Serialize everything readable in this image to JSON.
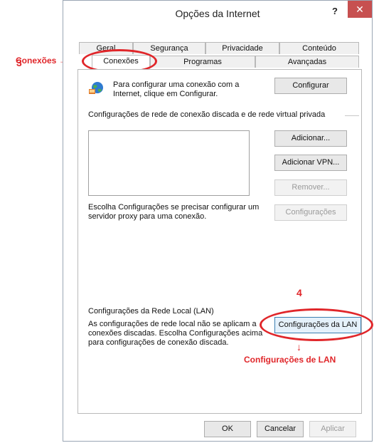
{
  "window": {
    "title": "Opções da Internet",
    "help_label": "?",
    "close_label": "✕"
  },
  "tabs_row1": [
    {
      "label": "Geral"
    },
    {
      "label": "Segurança"
    },
    {
      "label": "Privacidade"
    },
    {
      "label": "Conteúdo"
    }
  ],
  "tabs_row2": [
    {
      "label": "Conexões",
      "active": true
    },
    {
      "label": "Programas"
    },
    {
      "label": "Avançadas"
    }
  ],
  "setup": {
    "text": "Para configurar uma conexão com a Internet, clique em Configurar.",
    "button": "Configurar"
  },
  "dialup": {
    "heading": "Configurações de rede de conexão discada e de rede virtual privada",
    "add_button": "Adicionar...",
    "add_vpn_button": "Adicionar VPN...",
    "remove_button": "Remover...",
    "proxy_text": "Escolha Configurações se precisar configurar um servidor proxy para uma conexão.",
    "settings_button": "Configurações"
  },
  "lan": {
    "heading": "Configurações da Rede Local (LAN)",
    "text": "As configurações de rede local não se aplicam a conexões discadas. Escolha Configurações acima para configurações de conexão discada.",
    "button": "Configurações da LAN"
  },
  "footer": {
    "ok": "OK",
    "cancel": "Cancelar",
    "apply": "Aplicar"
  },
  "annotations": {
    "conexoes_label": "Conexões",
    "arrow": "→",
    "step3": "3",
    "step4": "4",
    "lan_label": "Configurações de LAN",
    "down_arrow": "↓",
    "color": "#e0262a"
  }
}
